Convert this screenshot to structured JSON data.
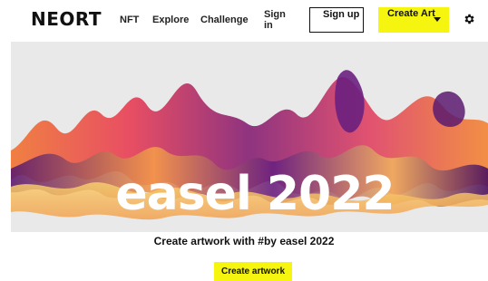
{
  "header": {
    "logo_text": "NEORT",
    "nav": {
      "nft": "NFT",
      "explore": "Explore",
      "challenge": "Challenge"
    },
    "sign_in": "Sign in",
    "sign_up": "Sign up",
    "create_art": "Create Art",
    "settings_icon": "gear-icon"
  },
  "hero": {
    "title": "easel 2022",
    "background_color": "#e9e9e9"
  },
  "main": {
    "subtitle": "Create artwork with #by easel 2022",
    "cta_label": "Create artwork"
  },
  "colors": {
    "accent_yellow": "#f5f510",
    "text": "#111111"
  }
}
